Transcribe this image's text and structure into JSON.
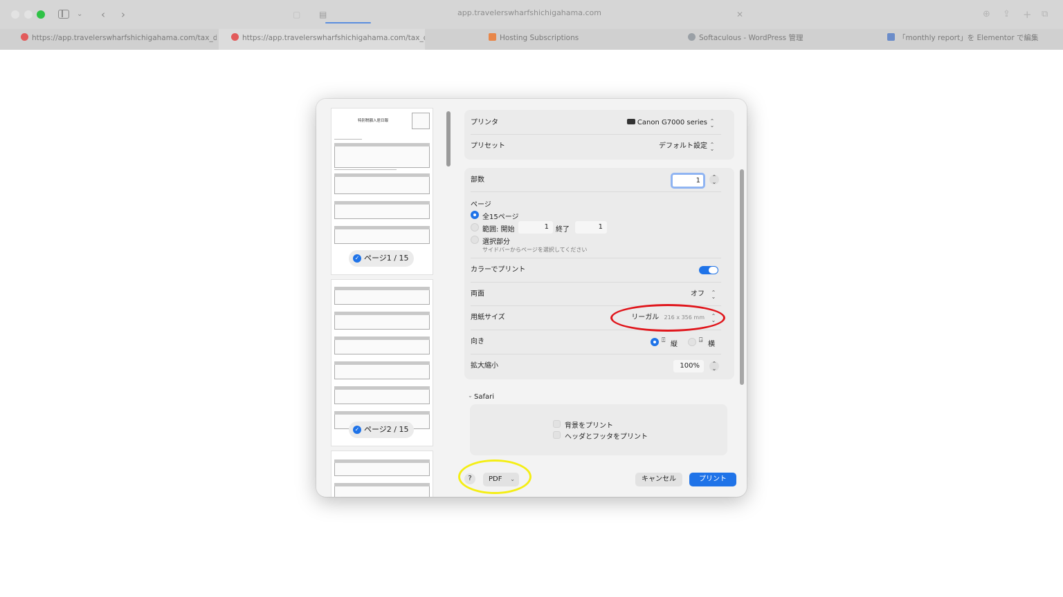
{
  "browser": {
    "address": "app.travelerswharfshichigahama.com",
    "tabs": [
      {
        "label": "https://app.travelerswharfshichigahama.com/tax_de...",
        "favicon_color": "#e25b5b"
      },
      {
        "label": "https://app.travelerswharfshichigahama.com/tax_d...",
        "favicon_color": "#e25b5b"
      },
      {
        "label": "Hosting Subscriptions",
        "favicon_color": "#e8874a"
      },
      {
        "label": "Softaculous - WordPress 管理",
        "favicon_color": "#9aa0a6"
      },
      {
        "label": "「monthly report」を Elementor で編集",
        "favicon_color": "#6b8cc9"
      }
    ]
  },
  "preview": {
    "thumb_title": "特別税額入居日報",
    "pages": [
      {
        "label": "ページ1 / 15"
      },
      {
        "label": "ページ2 / 15"
      }
    ]
  },
  "printer": {
    "label": "プリンタ",
    "value": "Canon G7000 series"
  },
  "preset": {
    "label": "プリセット",
    "value": "デフォルト設定"
  },
  "copies": {
    "label": "部数",
    "value": "1"
  },
  "pages": {
    "label": "ページ",
    "all": "全15ページ",
    "range_label": "範囲: 開始",
    "range_from": "1",
    "range_to_label": "終了",
    "range_to": "1",
    "selection": "選択部分",
    "selection_hint": "サイドバーからページを選択してください"
  },
  "color": {
    "label": "カラーでプリント"
  },
  "duplex": {
    "label": "両面",
    "value": "オフ"
  },
  "paper": {
    "label": "用紙サイズ",
    "value": "リーガル",
    "size": "216 x 356 mm"
  },
  "orientation": {
    "label": "向き",
    "portrait": "縦",
    "landscape": "横"
  },
  "scale": {
    "label": "拡大縮小",
    "value": "100%"
  },
  "safari": {
    "label": "Safari",
    "print_backgrounds": "背景をプリント",
    "print_headers": "ヘッダとフッタをプリント"
  },
  "footer": {
    "help": "?",
    "pdf": "PDF",
    "cancel": "キャンセル",
    "print": "プリント"
  }
}
